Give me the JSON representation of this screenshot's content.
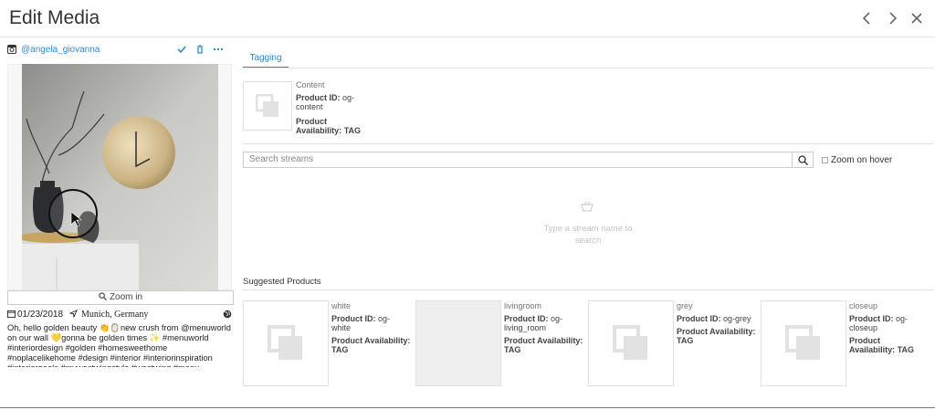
{
  "header": {
    "title": "Edit Media"
  },
  "media": {
    "handle": "@angela_giovanna",
    "zoom_label": "Zoom in",
    "date": "01/23/2018",
    "location": "Munich, Germany",
    "caption": "Oh, hello golden beauty 👏🪞new crush from @menuworld on our wall 💛gonna be golden times ✨ #menuworld #interiordesign #golden #homesweethome #noplacelikehome #design #interior #interiorinspiration #interiorgoals #mywestwingstyle #westwing #menu"
  },
  "tabs": [
    {
      "label": "Tagging"
    }
  ],
  "content_product": {
    "label": "Content",
    "id_label": "Product ID:",
    "id_value": "og-content",
    "availability_label": "Product Availability:",
    "availability_value": "TAG"
  },
  "search": {
    "placeholder": "Search streams",
    "zoom_on_hover_label": "Zoom on hover",
    "empty_text": "Type a stream name to search"
  },
  "suggested": {
    "title": "Suggested Products",
    "items": [
      {
        "label": "white",
        "id_label": "Product ID:",
        "id_value": "og-white",
        "availability_label": "Product Availability:",
        "availability_value": "TAG"
      },
      {
        "label": "livingroom",
        "id_label": "Product ID:",
        "id_value": "og-living_room",
        "availability_label": "Product Availability:",
        "availability_value": "TAG"
      },
      {
        "label": "grey",
        "id_label": "Product ID:",
        "id_value": "og-grey",
        "availability_label": "Product Availability:",
        "availability_value": "TAG"
      },
      {
        "label": "closeup",
        "id_label": "Product ID:",
        "id_value": "og-closeup",
        "availability_label": "Product Availability:",
        "availability_value": "TAG"
      }
    ]
  },
  "colors": {
    "accent": "#2a8bd4",
    "border": "#e0e0e0",
    "placeholder_icon": "#e2e2e2"
  },
  "icons": {
    "prev": "chevron-left-icon",
    "next": "chevron-right-icon",
    "close": "close-icon",
    "instagram": "instagram-icon",
    "approve": "check-icon",
    "delete": "trash-icon",
    "more": "more-icon",
    "search": "search-icon",
    "basket": "basket-icon"
  }
}
